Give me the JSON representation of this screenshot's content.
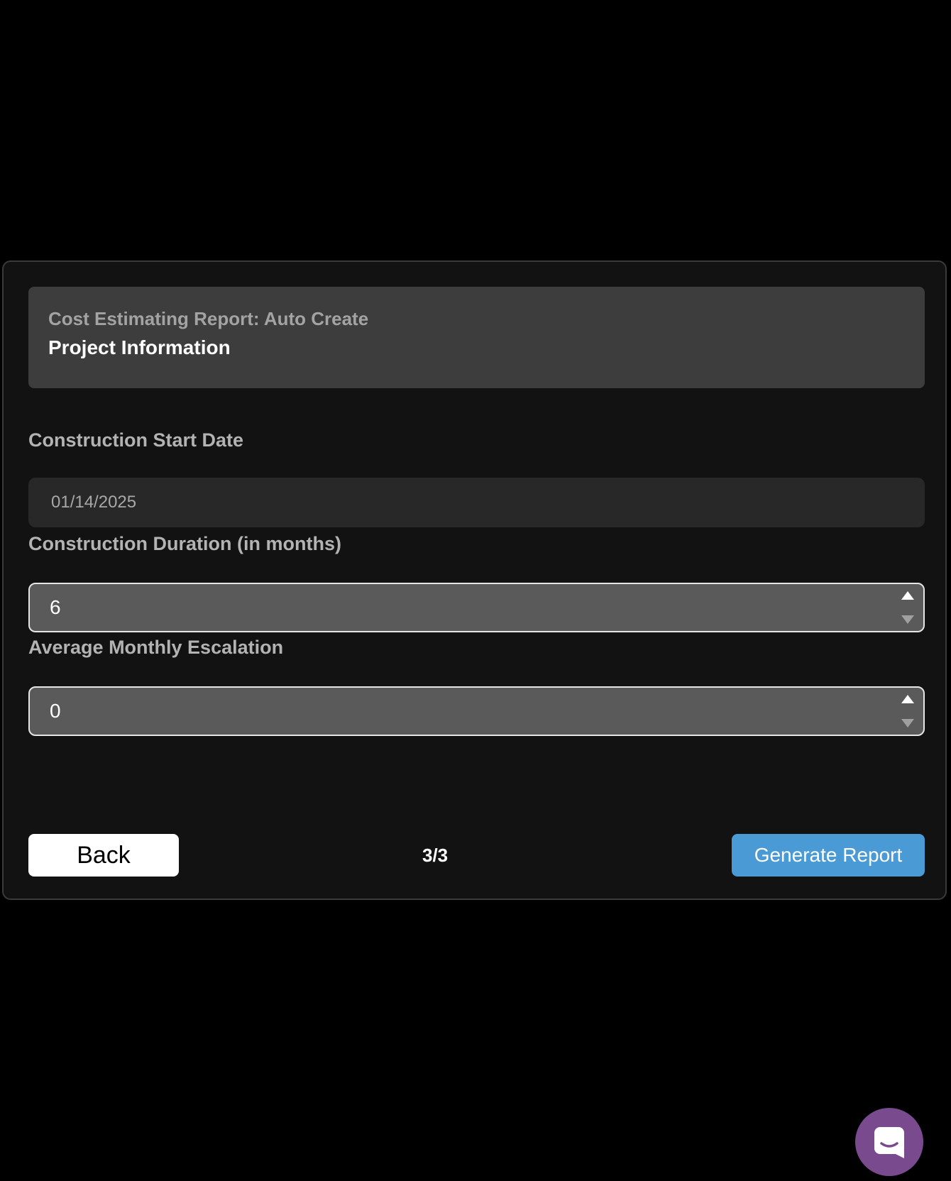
{
  "header": {
    "subtitle": "Cost Estimating Report: Auto Create",
    "title": "Project Information"
  },
  "fields": {
    "start_date": {
      "label": "Construction Start Date",
      "value": "01/14/2025"
    },
    "duration": {
      "label": "Construction Duration (in months)",
      "value": "6"
    },
    "escalation": {
      "label": "Average Monthly Escalation",
      "value": "0"
    }
  },
  "footer": {
    "back_label": "Back",
    "page_indicator": "3/3",
    "generate_label": "Generate Report"
  },
  "colors": {
    "accent": "#4a9ad6",
    "chat_launcher": "#7a4a8f"
  },
  "icons": {
    "chat": "chat-bubble-icon",
    "stepper_up": "arrow-up-icon",
    "stepper_down": "arrow-down-icon"
  }
}
